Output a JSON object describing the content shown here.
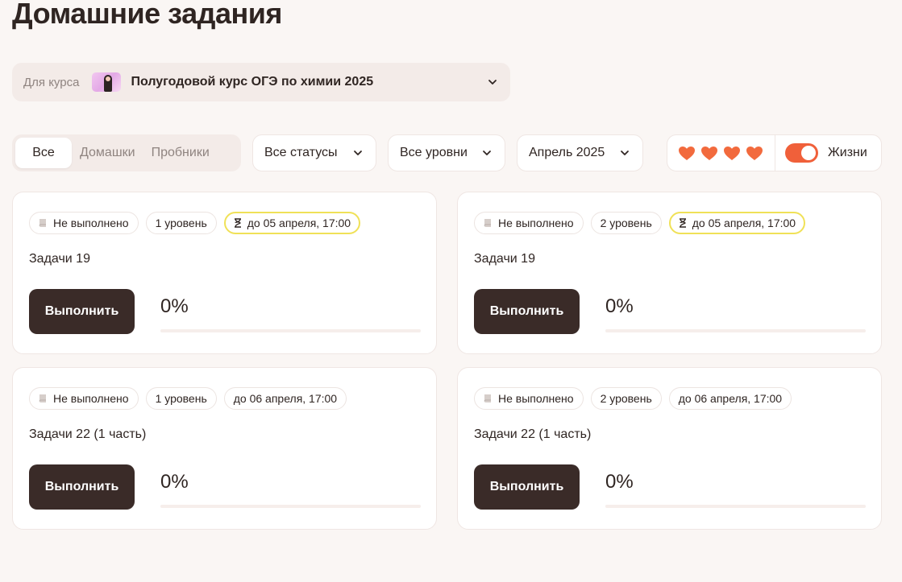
{
  "page": {
    "title": "Домашние задания"
  },
  "course": {
    "prefix": "Для курса",
    "name": "Полугодовой курс ОГЭ по химии 2025"
  },
  "filters": {
    "tabs": [
      {
        "label": "Все",
        "active": true
      },
      {
        "label": "Домашки",
        "active": false
      },
      {
        "label": "Пробники",
        "active": false
      }
    ],
    "status": "Все статусы",
    "level": "Все уровни",
    "month": "Апрель 2025"
  },
  "lives": {
    "hearts": 4,
    "heart_color": "#f26a3d",
    "toggle_on": true,
    "label": "Жизни"
  },
  "assignments": [
    {
      "status": "Не выполнено",
      "level": "1 уровень",
      "deadline": "до 05 апреля, 17:00",
      "deadline_urgent": true,
      "title": "Задачи 19",
      "button": "Выполнить",
      "progress_text": "0%",
      "progress": 0
    },
    {
      "status": "Не выполнено",
      "level": "2 уровень",
      "deadline": "до 05 апреля, 17:00",
      "deadline_urgent": true,
      "title": "Задачи 19",
      "button": "Выполнить",
      "progress_text": "0%",
      "progress": 0
    },
    {
      "status": "Не выполнено",
      "level": "1 уровень",
      "deadline": "до 06 апреля, 17:00",
      "deadline_urgent": false,
      "title": "Задачи 22 (1 часть)",
      "button": "Выполнить",
      "progress_text": "0%",
      "progress": 0
    },
    {
      "status": "Не выполнено",
      "level": "2 уровень",
      "deadline": "до 06 апреля, 17:00",
      "deadline_urgent": false,
      "title": "Задачи 22 (1 часть)",
      "button": "Выполнить",
      "progress_text": "0%",
      "progress": 0
    }
  ],
  "colors": {
    "accent": "#f0603a",
    "button_dark": "#3a2b28",
    "deadline_highlight": "#f0e157"
  }
}
